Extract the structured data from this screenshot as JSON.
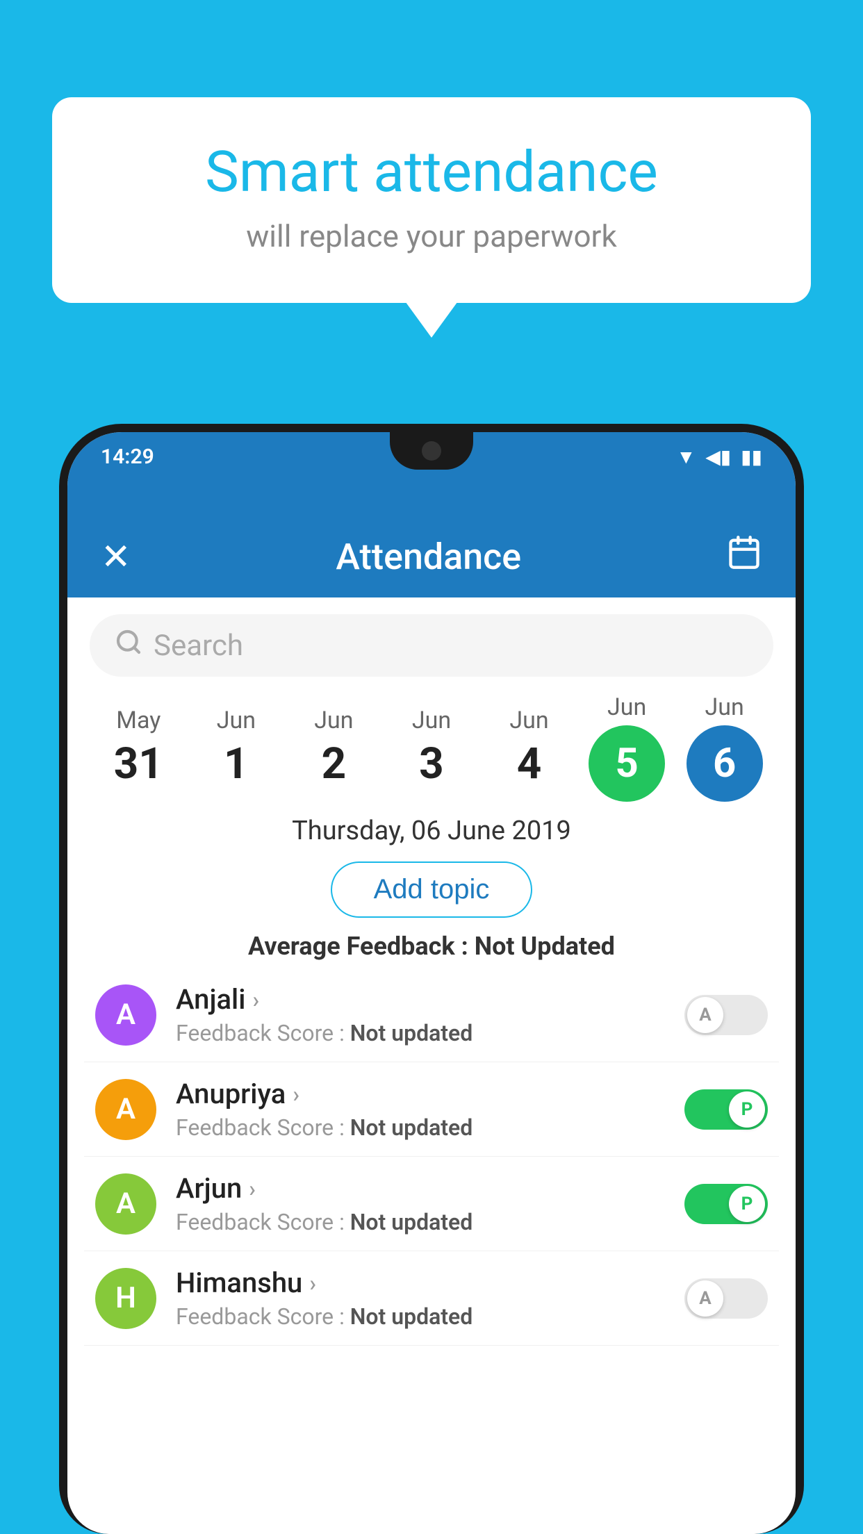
{
  "background_color": "#1ab8e8",
  "bubble": {
    "title": "Smart attendance",
    "subtitle": "will replace your paperwork"
  },
  "app": {
    "status_time": "14:29",
    "title": "Attendance",
    "close_icon": "✕",
    "calendar_icon": "📅"
  },
  "search": {
    "placeholder": "Search"
  },
  "dates": [
    {
      "month": "May",
      "day": "31",
      "selected": false
    },
    {
      "month": "Jun",
      "day": "1",
      "selected": false
    },
    {
      "month": "Jun",
      "day": "2",
      "selected": false
    },
    {
      "month": "Jun",
      "day": "3",
      "selected": false
    },
    {
      "month": "Jun",
      "day": "4",
      "selected": false
    },
    {
      "month": "Jun",
      "day": "5",
      "selected": "green"
    },
    {
      "month": "Jun",
      "day": "6",
      "selected": "blue"
    }
  ],
  "selected_date_label": "Thursday, 06 June 2019",
  "add_topic_label": "Add topic",
  "avg_feedback_label": "Average Feedback :",
  "avg_feedback_value": "Not Updated",
  "students": [
    {
      "name": "Anjali",
      "avatar_letter": "A",
      "avatar_color": "#a855f7",
      "feedback_label": "Feedback Score :",
      "feedback_value": "Not updated",
      "attendance": "absent"
    },
    {
      "name": "Anupriya",
      "avatar_letter": "A",
      "avatar_color": "#f59e0b",
      "feedback_label": "Feedback Score :",
      "feedback_value": "Not updated",
      "attendance": "present"
    },
    {
      "name": "Arjun",
      "avatar_letter": "A",
      "avatar_color": "#86c93a",
      "feedback_label": "Feedback Score :",
      "feedback_value": "Not updated",
      "attendance": "present"
    },
    {
      "name": "Himanshu",
      "avatar_letter": "H",
      "avatar_color": "#86c93a",
      "feedback_label": "Feedback Score :",
      "feedback_value": "Not updated",
      "attendance": "absent"
    }
  ]
}
